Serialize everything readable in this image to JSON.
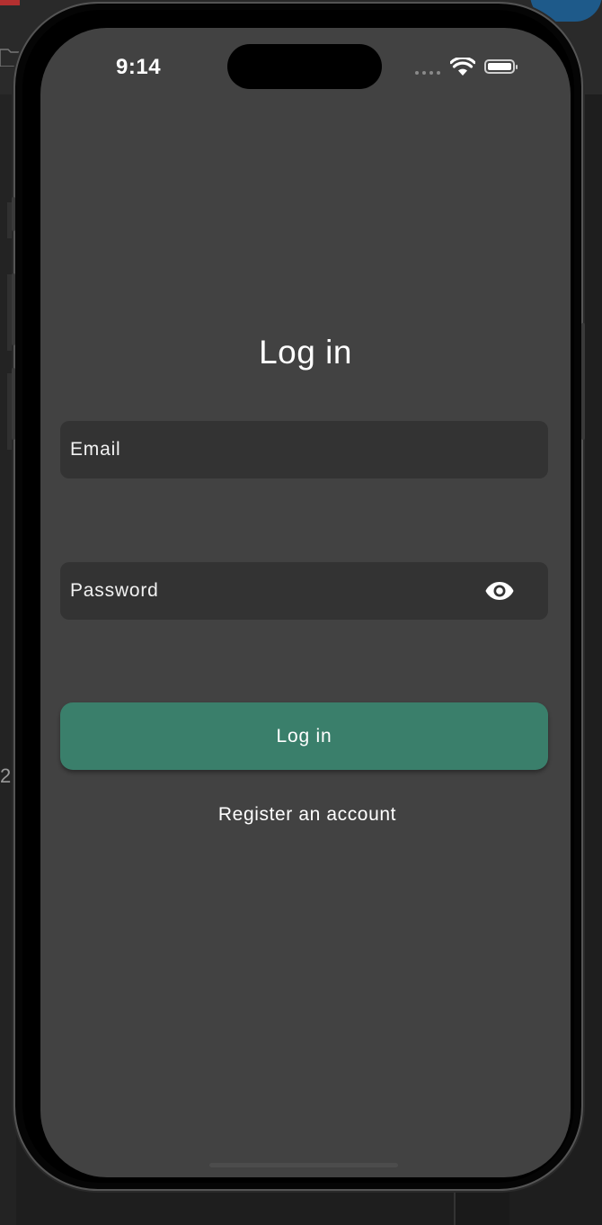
{
  "status_bar": {
    "time": "9:14",
    "wifi_icon": "wifi-icon",
    "battery_icon": "battery-icon",
    "signal_icon": "cellular-signal-dots-icon"
  },
  "login_screen": {
    "title": "Log in",
    "email_field": {
      "placeholder": "Email",
      "value": ""
    },
    "password_field": {
      "placeholder": "Password",
      "value": "",
      "visibility_icon": "eye-icon"
    },
    "login_button_label": "Log in",
    "register_link_label": "Register an account"
  },
  "colors": {
    "screen_background": "#424242",
    "field_background": "#333333",
    "accent_button": "#3a7f6b",
    "text": "#ffffff"
  },
  "desktop": {
    "stray_text": "2"
  }
}
